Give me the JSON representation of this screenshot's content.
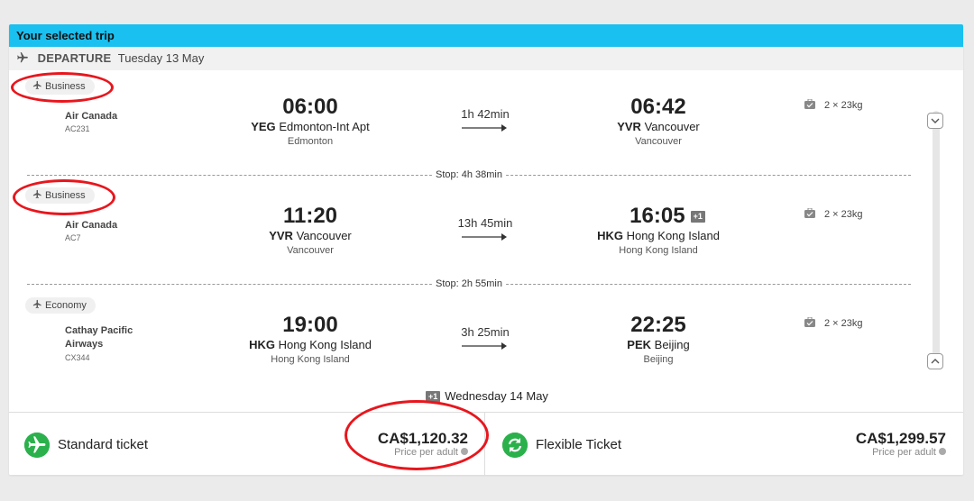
{
  "header": {
    "title": "Your selected trip"
  },
  "departure_bar": {
    "label": "DEPARTURE",
    "date": "Tuesday 13 May"
  },
  "segments": [
    {
      "cabin": "Business",
      "airline": "Air Canada",
      "flight": "AC231",
      "dep_time": "06:00",
      "dep_code": "YEG",
      "dep_airport": "Edmonton-Int Apt",
      "dep_city": "Edmonton",
      "duration": "1h 42min",
      "arr_time": "06:42",
      "arr_code": "YVR",
      "arr_airport": "Vancouver",
      "arr_city": "Vancouver",
      "baggage": "2 × 23kg"
    },
    {
      "cabin": "Business",
      "airline": "Air Canada",
      "flight": "AC7",
      "dep_time": "11:20",
      "dep_code": "YVR",
      "dep_airport": "Vancouver",
      "dep_city": "Vancouver",
      "duration": "13h 45min",
      "arr_time": "16:05",
      "arr_badge": "+1",
      "arr_code": "HKG",
      "arr_airport": "Hong Kong Island",
      "arr_city": "Hong Kong Island",
      "baggage": "2 × 23kg"
    },
    {
      "cabin": "Economy",
      "airline_line1": "Cathay Pacific",
      "airline_line2": "Airways",
      "flight": "CX344",
      "dep_time": "19:00",
      "dep_code": "HKG",
      "dep_airport": "Hong Kong Island",
      "dep_city": "Hong Kong Island",
      "duration": "3h 25min",
      "arr_time": "22:25",
      "arr_code": "PEK",
      "arr_airport": "Beijing",
      "arr_city": "Beijing",
      "baggage": "2 × 23kg"
    }
  ],
  "stops": [
    "Stop: 4h 38min",
    "Stop: 2h 55min"
  ],
  "next_day": {
    "badge": "+1",
    "text": "Wednesday 14 May"
  },
  "tickets": {
    "standard": {
      "label": "Standard ticket",
      "price": "CA$1,120.32",
      "price_note": "Price per adult"
    },
    "flexible": {
      "label": "Flexible Ticket",
      "price": "CA$1,299.57",
      "price_note": "Price per adult"
    }
  },
  "icons": {
    "plane": "plane-icon",
    "baggage": "baggage-icon",
    "scroll_down": "chevron-down-icon",
    "scroll_up": "chevron-up-icon",
    "standard_ticket": "plane-circle-icon",
    "flexible_ticket": "refresh-circle-icon",
    "info": "info-icon"
  },
  "colors": {
    "accent": "#1ac0ef",
    "ticket_green": "#2bb14c",
    "annotation_red": "#e8161d"
  }
}
